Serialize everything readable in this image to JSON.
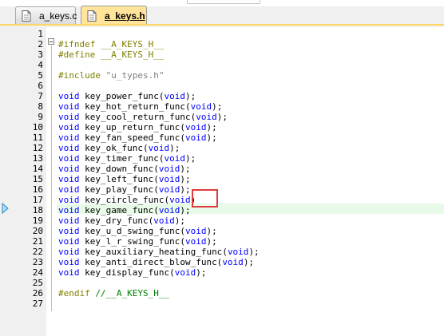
{
  "tabs": [
    {
      "label": "a_keys.c",
      "active": false,
      "icon": "document-icon"
    },
    {
      "label": "a_keys.h",
      "active": true,
      "icon": "document-icon"
    }
  ],
  "colors": {
    "keyword": "#0000ff",
    "preprocessor": "#808000",
    "string": "#808080",
    "comment": "#008000",
    "active_tab": "#ffe49a",
    "current_line": "#e8fbe8",
    "annotation": "#e03a3a"
  },
  "editor": {
    "current_line": 18,
    "annotated_line": 17,
    "lines": [
      {
        "n": "1",
        "parts": []
      },
      {
        "n": "2",
        "parts": [
          {
            "t": "#ifndef __A_KEYS_H__",
            "c": "pp"
          }
        ]
      },
      {
        "n": "3",
        "parts": [
          {
            "t": "#define __A_KEYS_H__",
            "c": "pp"
          }
        ]
      },
      {
        "n": "4",
        "parts": []
      },
      {
        "n": "5",
        "parts": [
          {
            "t": "#include ",
            "c": "pp"
          },
          {
            "t": "\"u_types.h\"",
            "c": "str"
          }
        ]
      },
      {
        "n": "6",
        "parts": []
      },
      {
        "n": "7",
        "parts": [
          {
            "t": "void",
            "c": "kw"
          },
          {
            "t": " key_power_func(",
            "c": ""
          },
          {
            "t": "void",
            "c": "kw"
          },
          {
            "t": ");",
            "c": ""
          }
        ]
      },
      {
        "n": "8",
        "parts": [
          {
            "t": "void",
            "c": "kw"
          },
          {
            "t": " key_hot_return_func(",
            "c": ""
          },
          {
            "t": "void",
            "c": "kw"
          },
          {
            "t": ");",
            "c": ""
          }
        ]
      },
      {
        "n": "9",
        "parts": [
          {
            "t": "void",
            "c": "kw"
          },
          {
            "t": " key_cool_return_func(",
            "c": ""
          },
          {
            "t": "void",
            "c": "kw"
          },
          {
            "t": ");",
            "c": ""
          }
        ]
      },
      {
        "n": "10",
        "parts": [
          {
            "t": "void",
            "c": "kw"
          },
          {
            "t": " key_up_return_func(",
            "c": ""
          },
          {
            "t": "void",
            "c": "kw"
          },
          {
            "t": ");",
            "c": ""
          }
        ]
      },
      {
        "n": "11",
        "parts": [
          {
            "t": "void",
            "c": "kw"
          },
          {
            "t": " key_fan_speed_func(",
            "c": ""
          },
          {
            "t": "void",
            "c": "kw"
          },
          {
            "t": ");",
            "c": ""
          }
        ]
      },
      {
        "n": "12",
        "parts": [
          {
            "t": "void",
            "c": "kw"
          },
          {
            "t": " key_ok_func(",
            "c": ""
          },
          {
            "t": "void",
            "c": "kw"
          },
          {
            "t": ");",
            "c": ""
          }
        ]
      },
      {
        "n": "13",
        "parts": [
          {
            "t": "void",
            "c": "kw"
          },
          {
            "t": " key_timer_func(",
            "c": ""
          },
          {
            "t": "void",
            "c": "kw"
          },
          {
            "t": ");",
            "c": ""
          }
        ]
      },
      {
        "n": "14",
        "parts": [
          {
            "t": "void",
            "c": "kw"
          },
          {
            "t": " key_down_func(",
            "c": ""
          },
          {
            "t": "void",
            "c": "kw"
          },
          {
            "t": ");",
            "c": ""
          }
        ]
      },
      {
        "n": "15",
        "parts": [
          {
            "t": "void",
            "c": "kw"
          },
          {
            "t": " key_left_func(",
            "c": ""
          },
          {
            "t": "void",
            "c": "kw"
          },
          {
            "t": ");",
            "c": ""
          }
        ]
      },
      {
        "n": "16",
        "parts": [
          {
            "t": "void",
            "c": "kw"
          },
          {
            "t": " key_play_func(",
            "c": ""
          },
          {
            "t": "void",
            "c": "kw"
          },
          {
            "t": ");",
            "c": ""
          }
        ]
      },
      {
        "n": "17",
        "parts": [
          {
            "t": "void",
            "c": "kw"
          },
          {
            "t": " key_circle_func(",
            "c": ""
          },
          {
            "t": "void",
            "c": "kw"
          },
          {
            "t": ")",
            "c": ""
          }
        ]
      },
      {
        "n": "18",
        "parts": [
          {
            "t": "void",
            "c": "kw"
          },
          {
            "t": " key_game_func(",
            "c": ""
          },
          {
            "t": "void",
            "c": "kw"
          },
          {
            "t": ");",
            "c": ""
          }
        ]
      },
      {
        "n": "19",
        "parts": [
          {
            "t": "void",
            "c": "kw"
          },
          {
            "t": " key_dry_func(",
            "c": ""
          },
          {
            "t": "void",
            "c": "kw"
          },
          {
            "t": ");",
            "c": ""
          }
        ]
      },
      {
        "n": "20",
        "parts": [
          {
            "t": "void",
            "c": "kw"
          },
          {
            "t": " key_u_d_swing_func(",
            "c": ""
          },
          {
            "t": "void",
            "c": "kw"
          },
          {
            "t": ");",
            "c": ""
          }
        ]
      },
      {
        "n": "21",
        "parts": [
          {
            "t": "void",
            "c": "kw"
          },
          {
            "t": " key_l_r_swing_func(",
            "c": ""
          },
          {
            "t": "void",
            "c": "kw"
          },
          {
            "t": ");",
            "c": ""
          }
        ]
      },
      {
        "n": "22",
        "parts": [
          {
            "t": "void",
            "c": "kw"
          },
          {
            "t": " key_auxiliary_heating_func(",
            "c": ""
          },
          {
            "t": "void",
            "c": "kw"
          },
          {
            "t": ");",
            "c": ""
          }
        ]
      },
      {
        "n": "23",
        "parts": [
          {
            "t": "void",
            "c": "kw"
          },
          {
            "t": " key_anti_direct_blow_func(",
            "c": ""
          },
          {
            "t": "void",
            "c": "kw"
          },
          {
            "t": ");",
            "c": ""
          }
        ]
      },
      {
        "n": "24",
        "parts": [
          {
            "t": "void",
            "c": "kw"
          },
          {
            "t": " key_display_func(",
            "c": ""
          },
          {
            "t": "void",
            "c": "kw"
          },
          {
            "t": ");",
            "c": ""
          }
        ]
      },
      {
        "n": "25",
        "parts": []
      },
      {
        "n": "26",
        "parts": [
          {
            "t": "#endif ",
            "c": "pp"
          },
          {
            "t": "//__A_KEYS_H__",
            "c": "cm"
          }
        ]
      },
      {
        "n": "27",
        "parts": []
      }
    ]
  }
}
